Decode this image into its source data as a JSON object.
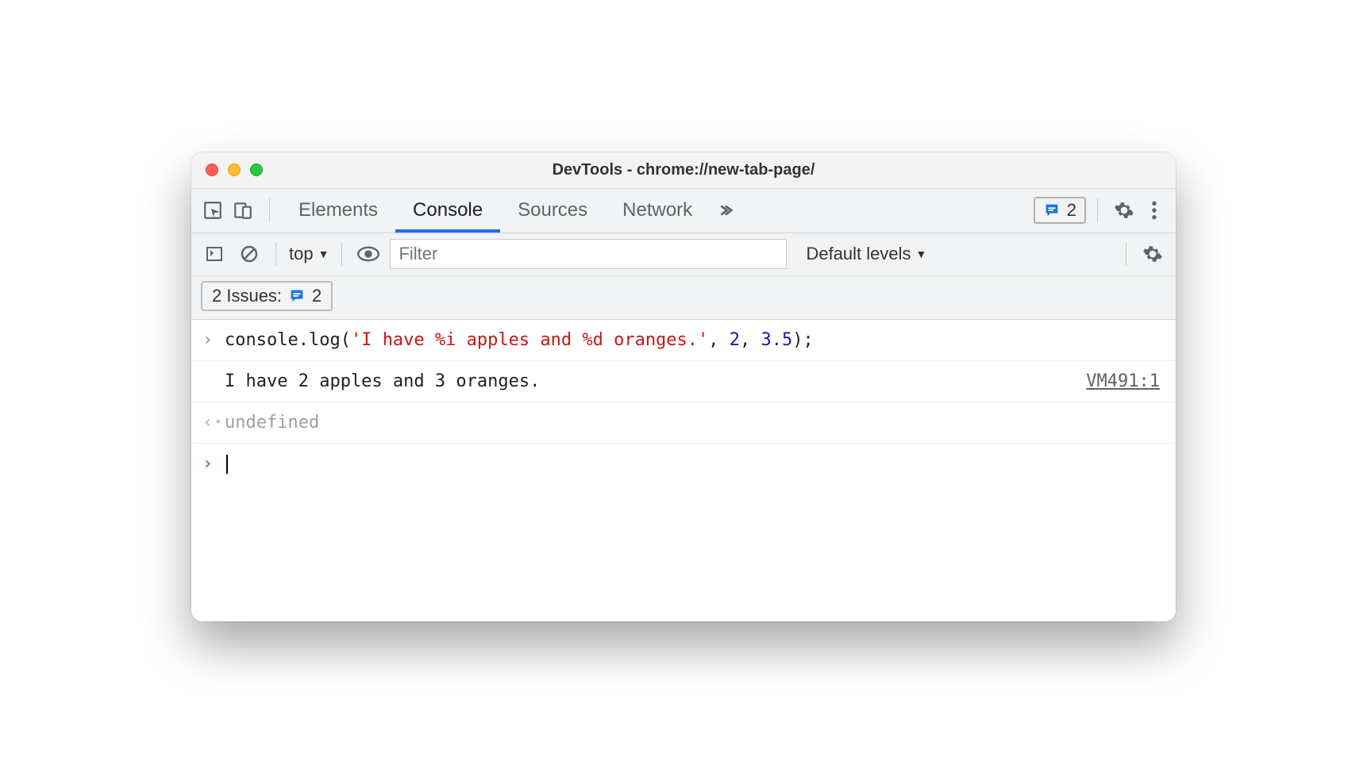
{
  "window": {
    "title": "DevTools - chrome://new-tab-page/"
  },
  "tabs": {
    "elements": "Elements",
    "console": "Console",
    "sources": "Sources",
    "network": "Network",
    "issues_count": "2"
  },
  "toolbar": {
    "context": "top",
    "filter_placeholder": "Filter",
    "levels": "Default levels"
  },
  "issues": {
    "label": "2 Issues:",
    "count": "2"
  },
  "console": {
    "input": {
      "fn": "console.log",
      "open": "(",
      "str": "'I have %i apples and %d oranges.'",
      "sep1": ", ",
      "arg1": "2",
      "sep2": ", ",
      "arg2": "3.5",
      "close": ");"
    },
    "output_text": "I have 2 apples and 3 oranges.",
    "output_source": "VM491:1",
    "return_value": "undefined"
  }
}
